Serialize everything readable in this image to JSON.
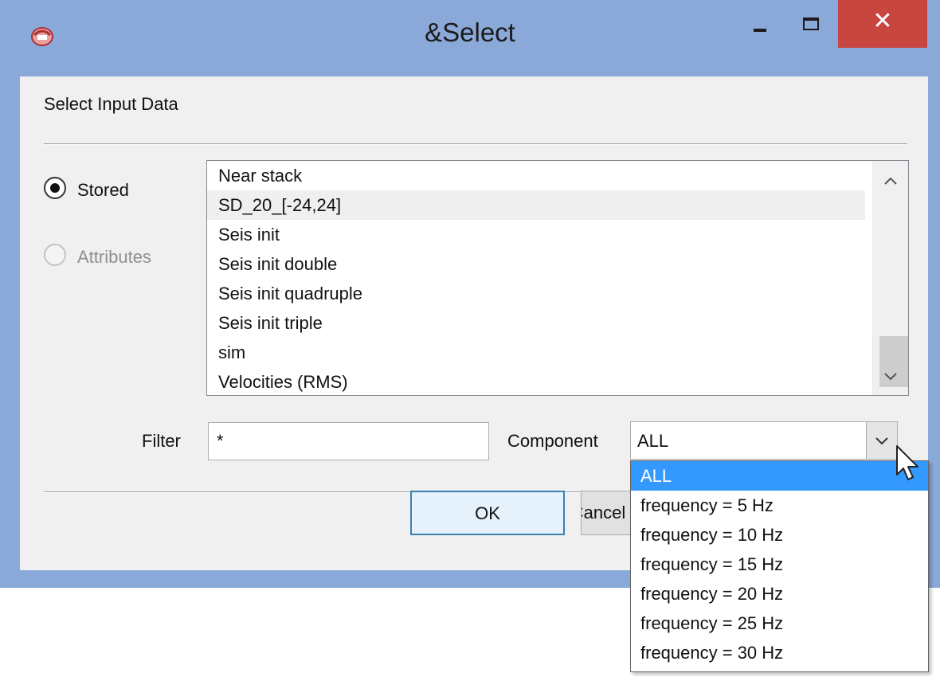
{
  "window": {
    "title": "&Select",
    "close_glyph": "✕",
    "icon": "app-logo-icon"
  },
  "dialog": {
    "heading": "Select Input Data",
    "radios": [
      {
        "label": "Stored",
        "checked": true,
        "enabled": true
      },
      {
        "label": "Attributes",
        "checked": false,
        "enabled": false
      }
    ],
    "list": {
      "items": [
        "Near stack",
        "SD_20_[-24,24]",
        "Seis init",
        "Seis init double",
        "Seis init quadruple",
        "Seis init triple",
        "sim",
        "Velocities (RMS)"
      ],
      "selected": "SD_20_[-24,24]",
      "scroll_up": "^",
      "scroll_down": "v"
    },
    "filter": {
      "label": "Filter",
      "value": "*"
    },
    "component": {
      "label": "Component",
      "value": "ALL",
      "arrow": "v",
      "options": [
        "ALL",
        "frequency = 5 Hz",
        "frequency = 10 Hz",
        "frequency = 15 Hz",
        "frequency = 20 Hz",
        "frequency = 25 Hz",
        "frequency = 30 Hz"
      ],
      "highlighted": "ALL"
    },
    "buttons": {
      "ok": "OK",
      "cancel": "Cancel"
    }
  },
  "colors": {
    "titlebar": "#8aa8d8",
    "close": "#c7463f",
    "highlight": "#3399ff"
  }
}
